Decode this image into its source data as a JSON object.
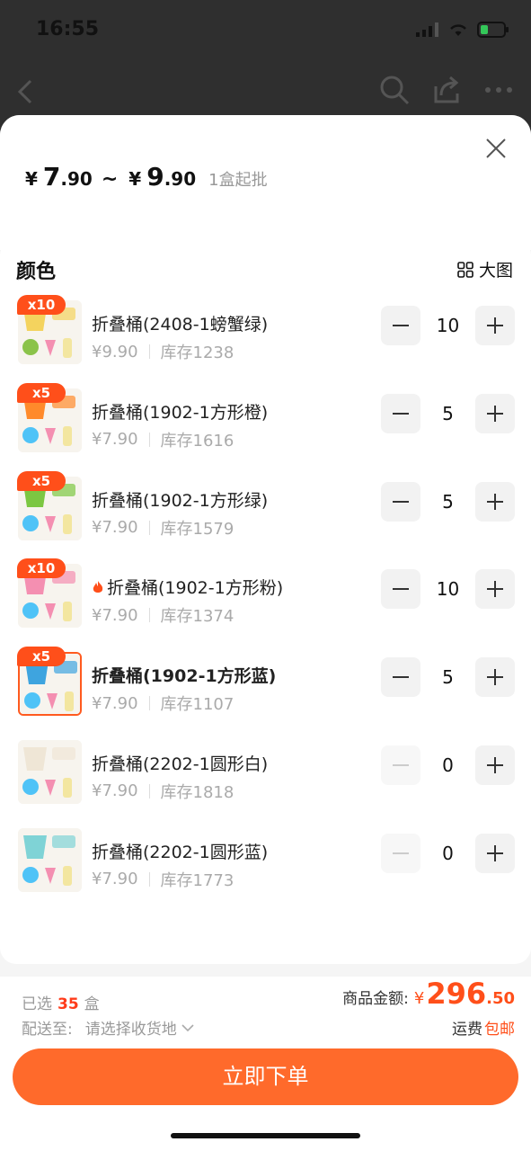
{
  "status_bar": {
    "time": "16:55"
  },
  "header": {
    "currency": "¥",
    "price_min_int": "7",
    "price_min_dec": ".90",
    "tilde": "~",
    "price_max_int": "9",
    "price_max_dec": ".90",
    "moq": "1盒起批"
  },
  "variants": {
    "title": "颜色",
    "bigview_label": "大图",
    "items": [
      {
        "badge": "x10",
        "name": "折叠桶(2408-1螃蟹绿)",
        "price": "¥9.90",
        "stock": "库存1238",
        "qty": "10",
        "minus_enabled": true,
        "selected": false,
        "bold": false,
        "hot": false
      },
      {
        "badge": "x5",
        "name": "折叠桶(1902-1方形橙)",
        "price": "¥7.90",
        "stock": "库存1616",
        "qty": "5",
        "minus_enabled": true,
        "selected": false,
        "bold": false,
        "hot": false
      },
      {
        "badge": "x5",
        "name": "折叠桶(1902-1方形绿)",
        "price": "¥7.90",
        "stock": "库存1579",
        "qty": "5",
        "minus_enabled": true,
        "selected": false,
        "bold": false,
        "hot": false
      },
      {
        "badge": "x10",
        "name": "折叠桶(1902-1方形粉)",
        "price": "¥7.90",
        "stock": "库存1374",
        "qty": "10",
        "minus_enabled": true,
        "selected": false,
        "bold": false,
        "hot": true
      },
      {
        "badge": "x5",
        "name": "折叠桶(1902-1方形蓝)",
        "price": "¥7.90",
        "stock": "库存1107",
        "qty": "5",
        "minus_enabled": true,
        "selected": true,
        "bold": true,
        "hot": false
      },
      {
        "badge": "",
        "name": "折叠桶(2202-1圆形白)",
        "price": "¥7.90",
        "stock": "库存1818",
        "qty": "0",
        "minus_enabled": false,
        "selected": false,
        "bold": false,
        "hot": false
      },
      {
        "badge": "",
        "name": "折叠桶(2202-1圆形蓝)",
        "price": "¥7.90",
        "stock": "库存1773",
        "qty": "0",
        "minus_enabled": false,
        "selected": false,
        "bold": false,
        "hot": false
      }
    ]
  },
  "footer": {
    "selected_prefix": "已选",
    "selected_count": "35",
    "selected_unit": "盒",
    "ship_label": "配送至:",
    "ship_value": "请选择收货地",
    "total_label": "商品金额:",
    "total_currency": "¥",
    "total_int": "296",
    "total_dec": ".50",
    "freight_label": "运费",
    "freight_value": "包邮",
    "order_button": "立即下单"
  },
  "colors": {
    "accent": "#ff4f1a",
    "order_button": "#ff6a2b"
  }
}
